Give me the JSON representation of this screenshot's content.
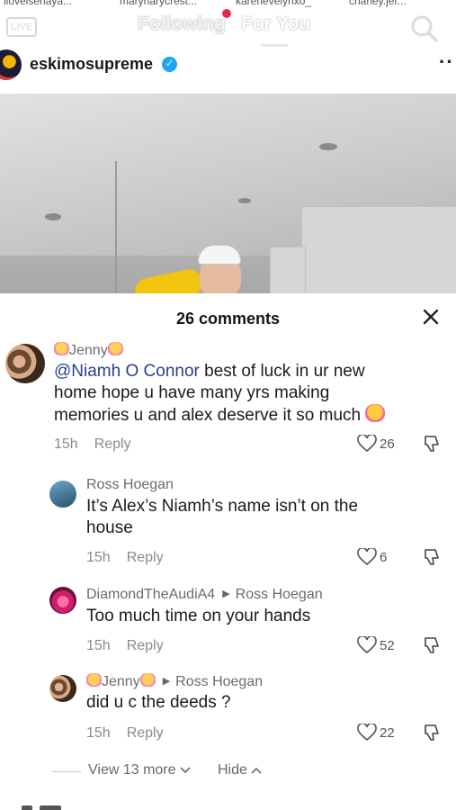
{
  "top": {
    "stories": [
      "ilovelsenaya...",
      "maryharycrest...",
      "karenevelyrixo_",
      "charley.jer..."
    ],
    "live_label": "LIVE",
    "tabs": {
      "following": "Following",
      "for_you": "For You"
    }
  },
  "author": {
    "name": "eskimosupreme",
    "verified_mark": "✓",
    "menu_icon": "more-icon"
  },
  "comments_header": {
    "title": "26 comments"
  },
  "comments": [
    {
      "user": "Jenny",
      "mention": "@Niamh O Connor",
      "text_line1": " best of luck in ur new",
      "text_line2": "home hope u have many yrs making",
      "text_line3": "memories u and alex deserve it so much",
      "time": "15h",
      "reply": "Reply",
      "likes": "26"
    },
    {
      "user": "Ross Hoegan",
      "text_line1": "It’s Alex’s Niamh’s name isn’t on the",
      "text_line2": "house",
      "time": "15h",
      "reply": "Reply",
      "likes": "6"
    },
    {
      "user": "DiamondTheAudiA4",
      "reply_to": "Ross Hoegan",
      "text_line1": "Too much time on your hands",
      "time": "15h",
      "reply": "Reply",
      "likes": "52"
    },
    {
      "user": "Jenny",
      "reply_to": "Ross Hoegan",
      "text_line1": "did u c the deeds ?",
      "time": "15h",
      "reply": "Reply",
      "likes": "22"
    }
  ],
  "view_more": {
    "label": "View 13 more",
    "hide": "Hide"
  },
  "colors": {
    "mention": "#2a3f86",
    "verified": "#20a5f2",
    "live_dot": "#e8294f"
  }
}
